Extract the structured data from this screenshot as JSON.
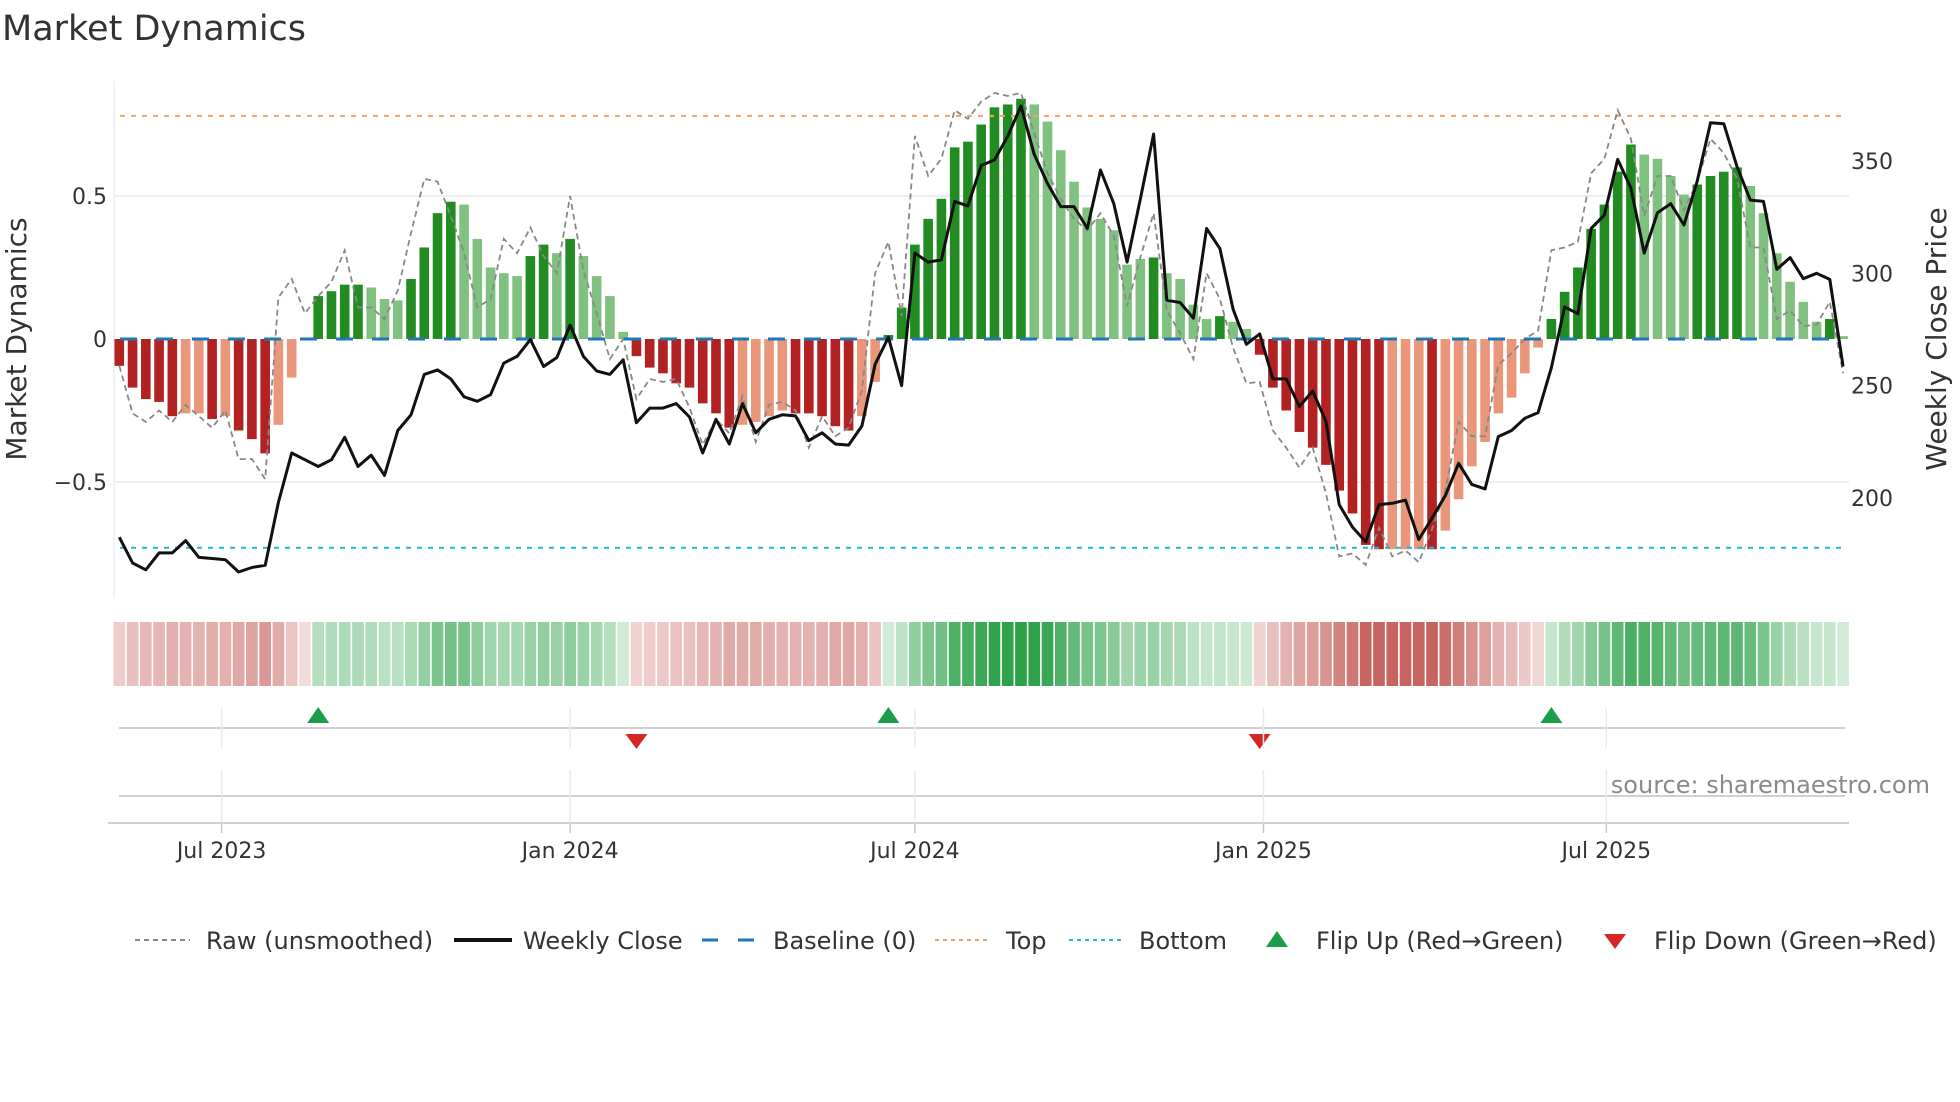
{
  "title": "Market Dynamics",
  "source": "source: sharemaestro.com",
  "chart_data": {
    "type": "bar",
    "title": "Market Dynamics",
    "x_start": "2023-05-08",
    "x_freq": "weekly",
    "ylabel": "Market Dynamics",
    "y2label": "Weekly Close Price",
    "ylim": [
      -0.905,
      0.905
    ],
    "y2lim": [
      155.4,
      385.6
    ],
    "yticks": [
      {
        "value": 0.5,
        "label": "0.5"
      },
      {
        "value": 0,
        "label": "0"
      },
      {
        "value": -0.5,
        "label": "−0.5"
      }
    ],
    "y2ticks": [
      {
        "value": 350,
        "label": "350"
      },
      {
        "value": 300,
        "label": "300"
      },
      {
        "value": 250,
        "label": "250"
      },
      {
        "value": 200,
        "label": "200"
      }
    ],
    "xticks": [
      {
        "date": "2023-07-01",
        "label": "Jul 2023"
      },
      {
        "date": "2024-01-01",
        "label": "Jan 2024"
      },
      {
        "date": "2024-07-01",
        "label": "Jul 2024"
      },
      {
        "date": "2025-01-01",
        "label": "Jan 2025"
      },
      {
        "date": "2025-07-01",
        "label": "Jul 2025"
      }
    ],
    "grid": true,
    "legend_position": "bottom",
    "thresholds": {
      "top": 0.78,
      "bottom": -0.73,
      "baseline": 0
    },
    "colors": {
      "strong_positive": "#228b22",
      "weak_positive": "#80c080",
      "strong_negative": "#b22222",
      "weak_negative": "#e9967a",
      "raw": "#888888",
      "close": "#111111",
      "baseline": "#1f77b4",
      "top": "#f4a460",
      "bottom": "#17becf",
      "flip_up": "#1a9e4a",
      "flip_down": "#d62728",
      "heat_positive": "#28a046",
      "heat_negative": "#c0504d"
    },
    "series": [
      {
        "name": "Market Dynamics (smoothed)",
        "type": "bar",
        "values": [
          -0.094,
          -0.17,
          -0.21,
          -0.22,
          -0.27,
          -0.26,
          -0.26,
          -0.28,
          -0.27,
          -0.32,
          -0.35,
          -0.4,
          -0.3,
          -0.135,
          -0.005,
          0.15,
          0.167,
          0.19,
          0.19,
          0.18,
          0.14,
          0.135,
          0.21,
          0.32,
          0.44,
          0.48,
          0.47,
          0.35,
          0.25,
          0.23,
          0.22,
          0.29,
          0.33,
          0.3,
          0.35,
          0.29,
          0.22,
          0.15,
          0.025,
          -0.06,
          -0.1,
          -0.12,
          -0.155,
          -0.17,
          -0.225,
          -0.26,
          -0.31,
          -0.3,
          -0.29,
          -0.27,
          -0.25,
          -0.26,
          -0.26,
          -0.27,
          -0.305,
          -0.32,
          -0.27,
          -0.15,
          0.014,
          0.11,
          0.33,
          0.42,
          0.49,
          0.67,
          0.69,
          0.75,
          0.81,
          0.82,
          0.84,
          0.82,
          0.76,
          0.66,
          0.55,
          0.46,
          0.42,
          0.38,
          0.26,
          0.28,
          0.285,
          0.23,
          0.21,
          0.12,
          0.07,
          0.08,
          0.06,
          0.035,
          -0.055,
          -0.17,
          -0.25,
          -0.325,
          -0.38,
          -0.44,
          -0.53,
          -0.61,
          -0.72,
          -0.735,
          -0.735,
          -0.735,
          -0.735,
          -0.735,
          -0.67,
          -0.56,
          -0.445,
          -0.36,
          -0.26,
          -0.205,
          -0.12,
          -0.03,
          0.07,
          0.165,
          0.25,
          0.385,
          0.47,
          0.585,
          0.68,
          0.645,
          0.63,
          0.57,
          0.505,
          0.54,
          0.57,
          0.585,
          0.6,
          0.535,
          0.44,
          0.3,
          0.2,
          0.13,
          0.06,
          0.07,
          0.01
        ],
        "strengthening": [
          1,
          1,
          1,
          1,
          1,
          0,
          0,
          1,
          0,
          1,
          1,
          1,
          0,
          0,
          0,
          1,
          1,
          1,
          1,
          0,
          0,
          0,
          1,
          1,
          1,
          1,
          0,
          0,
          0,
          0,
          0,
          1,
          1,
          0,
          1,
          0,
          0,
          0,
          0,
          1,
          1,
          1,
          1,
          1,
          1,
          1,
          1,
          0,
          0,
          0,
          0,
          1,
          1,
          1,
          1,
          1,
          0,
          0,
          1,
          1,
          1,
          1,
          1,
          1,
          1,
          1,
          1,
          1,
          1,
          0,
          0,
          0,
          0,
          0,
          0,
          0,
          0,
          0,
          1,
          0,
          0,
          0,
          0,
          1,
          0,
          0,
          1,
          1,
          1,
          1,
          1,
          1,
          1,
          1,
          1,
          1,
          0,
          0,
          0,
          1,
          0,
          0,
          0,
          0,
          0,
          0,
          0,
          0,
          1,
          1,
          1,
          1,
          1,
          1,
          1,
          0,
          0,
          0,
          0,
          1,
          1,
          1,
          1,
          0,
          0,
          0,
          0,
          0,
          0,
          1,
          0
        ]
      },
      {
        "name": "Raw (unsmoothed)",
        "type": "line",
        "values": [
          -0.094,
          -0.26,
          -0.29,
          -0.25,
          -0.29,
          -0.23,
          -0.27,
          -0.31,
          -0.25,
          -0.42,
          -0.42,
          -0.49,
          0.145,
          0.21,
          0.09,
          0.15,
          0.2,
          0.31,
          0.11,
          0.11,
          0.07,
          0.17,
          0.37,
          0.56,
          0.55,
          0.43,
          0.3,
          0.11,
          0.14,
          0.35,
          0.3,
          0.39,
          0.29,
          0.23,
          0.5,
          0.24,
          0.09,
          -0.07,
          0.0,
          -0.21,
          -0.14,
          -0.15,
          -0.14,
          -0.24,
          -0.37,
          -0.28,
          -0.33,
          -0.2,
          -0.36,
          -0.23,
          -0.22,
          -0.25,
          -0.38,
          -0.27,
          -0.34,
          -0.31,
          -0.18,
          0.23,
          0.34,
          0.08,
          0.71,
          0.57,
          0.63,
          0.8,
          0.77,
          0.83,
          0.86,
          0.85,
          0.86,
          0.72,
          0.58,
          0.49,
          0.42,
          0.38,
          0.44,
          0.36,
          0.115,
          0.285,
          0.44,
          0.1,
          0.02,
          -0.07,
          0.23,
          0.14,
          -0.03,
          -0.155,
          -0.15,
          -0.32,
          -0.38,
          -0.45,
          -0.38,
          -0.54,
          -0.76,
          -0.75,
          -0.79,
          -0.66,
          -0.76,
          -0.74,
          -0.78,
          -0.665,
          -0.53,
          -0.29,
          -0.34,
          -0.34,
          -0.09,
          -0.05,
          0.0,
          0.03,
          0.31,
          0.32,
          0.34,
          0.58,
          0.63,
          0.8,
          0.7,
          0.43,
          0.57,
          0.57,
          0.45,
          0.55,
          0.7,
          0.65,
          0.56,
          0.32,
          0.32,
          0.07,
          0.1,
          0.045,
          0.05,
          0.13,
          -0.12
        ]
      },
      {
        "name": "Weekly Close",
        "type": "line",
        "axis": "right",
        "values": [
          182.5,
          171,
          168,
          175.5,
          175.5,
          181,
          173.5,
          173,
          172.5,
          167,
          169,
          170,
          198,
          220,
          217,
          214,
          217,
          227,
          214,
          219,
          210,
          230,
          237,
          255,
          257,
          253,
          245,
          243,
          246,
          260,
          263,
          270.5,
          258.5,
          262.5,
          277,
          263,
          256.5,
          255,
          261.5,
          233.5,
          240,
          240,
          242,
          236,
          220,
          235,
          224,
          242,
          229,
          235,
          237,
          236.5,
          225.5,
          229,
          224,
          223.5,
          232,
          259.5,
          271.5,
          250,
          309,
          305,
          306,
          332,
          330,
          348,
          350.5,
          361,
          374.5,
          353,
          340,
          329.7,
          329.7,
          320,
          346,
          331,
          305,
          333,
          362,
          288,
          287,
          280,
          320,
          311,
          284,
          268.4,
          273,
          253,
          253,
          240.7,
          247.6,
          234,
          197,
          187,
          180.5,
          197,
          197.6,
          199,
          181.5,
          191,
          201,
          215.4,
          206,
          204,
          227.3,
          230,
          235.5,
          238,
          258,
          285,
          282,
          320,
          326,
          350.7,
          338,
          309,
          327,
          331,
          321.5,
          341,
          367,
          366.6,
          347.5,
          332.6,
          332,
          301.8,
          307,
          297.6,
          300,
          297.3,
          258.5
        ]
      }
    ],
    "flips": {
      "up_indices": [
        15,
        58,
        108
      ],
      "down_indices": [
        39,
        86
      ]
    },
    "legend": [
      {
        "key": "raw",
        "label": "Raw (unsmoothed)"
      },
      {
        "key": "close",
        "label": "Weekly Close"
      },
      {
        "key": "baseline",
        "label": "Baseline (0)"
      },
      {
        "key": "top",
        "label": "Top"
      },
      {
        "key": "bottom",
        "label": "Bottom"
      },
      {
        "key": "flip_up",
        "label": "Flip Up (Red→Green)"
      },
      {
        "key": "flip_down",
        "label": "Flip Down (Green→Red)"
      }
    ]
  }
}
